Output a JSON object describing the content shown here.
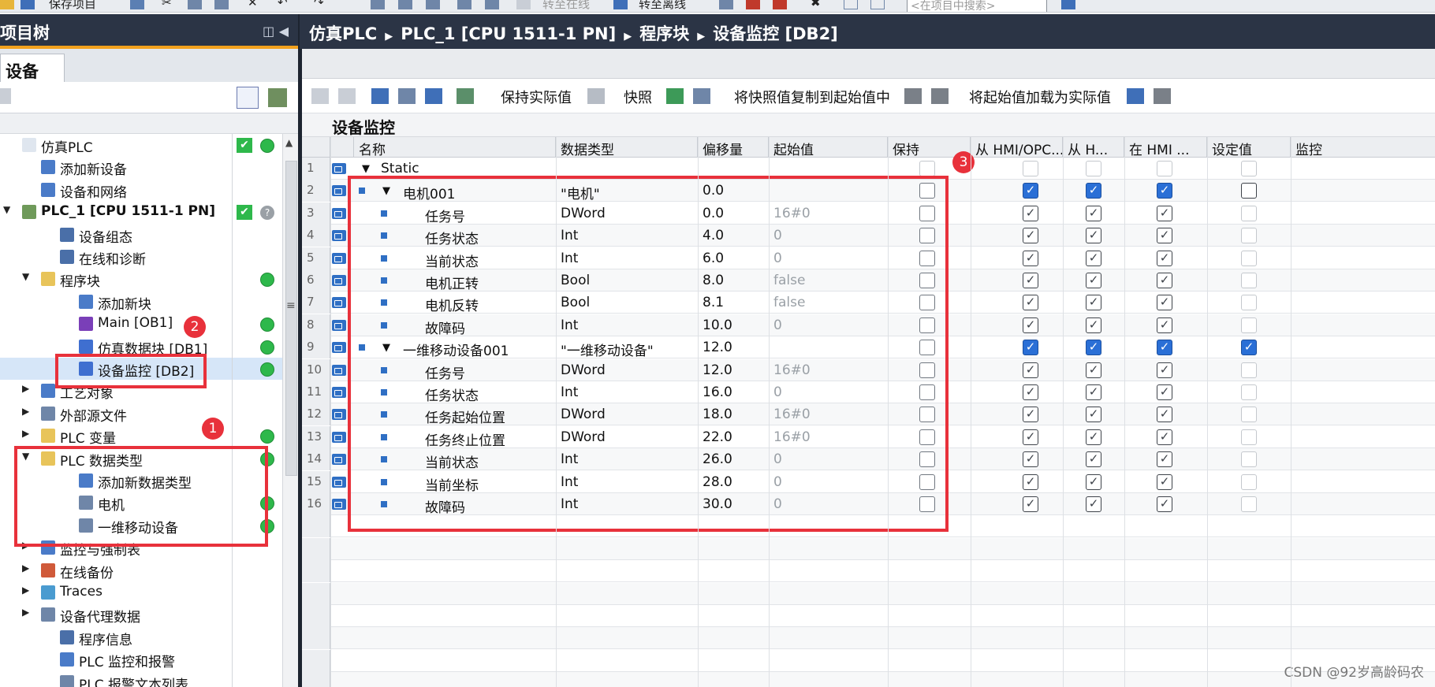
{
  "toolbar": {
    "save_label": "保存项目",
    "go_online": "转至在线",
    "go_offline": "转至离线",
    "search_placeholder": "<在项目中搜索>"
  },
  "left_panel": {
    "title": "项目树",
    "tab": "设备",
    "tree": [
      {
        "label": "仿真PLC",
        "indent": 0,
        "arrow": "",
        "icon": "document-icon",
        "status": "check-dot"
      },
      {
        "label": "添加新设备",
        "indent": 1,
        "arrow": "",
        "icon": "add-device-icon",
        "status": ""
      },
      {
        "label": "设备和网络",
        "indent": 1,
        "arrow": "",
        "icon": "network-icon",
        "status": ""
      },
      {
        "label": "PLC_1 [CPU 1511-1 PN]",
        "indent": 0,
        "arrow": "▼",
        "icon": "plc-icon",
        "status": "check-question",
        "bold": true
      },
      {
        "label": "设备组态",
        "indent": 2,
        "arrow": "",
        "icon": "device-config-icon",
        "status": ""
      },
      {
        "label": "在线和诊断",
        "indent": 2,
        "arrow": "",
        "icon": "diagnostics-icon",
        "status": ""
      },
      {
        "label": "程序块",
        "indent": 1,
        "arrow": "▼",
        "icon": "folder-icon",
        "status": "dot"
      },
      {
        "label": "添加新块",
        "indent": 3,
        "arrow": "",
        "icon": "add-block-icon",
        "status": ""
      },
      {
        "label": "Main [OB1]",
        "indent": 3,
        "arrow": "",
        "icon": "ob-icon",
        "status": "dot"
      },
      {
        "label": "仿真数据块 [DB1]",
        "indent": 3,
        "arrow": "",
        "icon": "db-icon",
        "status": "dot"
      },
      {
        "label": "设备监控 [DB2]",
        "indent": 3,
        "arrow": "",
        "icon": "db-icon",
        "status": "dot",
        "selected": true
      },
      {
        "label": "工艺对象",
        "indent": 1,
        "arrow": "▶",
        "icon": "tech-object-icon",
        "status": ""
      },
      {
        "label": "外部源文件",
        "indent": 1,
        "arrow": "▶",
        "icon": "source-file-icon",
        "status": ""
      },
      {
        "label": "PLC 变量",
        "indent": 1,
        "arrow": "▶",
        "icon": "tag-icon",
        "status": "dot"
      },
      {
        "label": "PLC 数据类型",
        "indent": 1,
        "arrow": "▼",
        "icon": "datatype-folder-icon",
        "status": "dot"
      },
      {
        "label": "添加新数据类型",
        "indent": 3,
        "arrow": "",
        "icon": "add-type-icon",
        "status": ""
      },
      {
        "label": "电机",
        "indent": 3,
        "arrow": "",
        "icon": "udt-icon",
        "status": "dot"
      },
      {
        "label": "一维移动设备",
        "indent": 3,
        "arrow": "",
        "icon": "udt-icon",
        "status": "dot"
      },
      {
        "label": "监控与强制表",
        "indent": 1,
        "arrow": "▶",
        "icon": "watch-table-icon",
        "status": ""
      },
      {
        "label": "在线备份",
        "indent": 1,
        "arrow": "▶",
        "icon": "backup-icon",
        "status": ""
      },
      {
        "label": "Traces",
        "indent": 1,
        "arrow": "▶",
        "icon": "trace-icon",
        "status": ""
      },
      {
        "label": "设备代理数据",
        "indent": 1,
        "arrow": "▶",
        "icon": "proxy-icon",
        "status": ""
      },
      {
        "label": "程序信息",
        "indent": 2,
        "arrow": "",
        "icon": "program-info-icon",
        "status": ""
      },
      {
        "label": "PLC 监控和报警",
        "indent": 2,
        "arrow": "",
        "icon": "alarm-icon",
        "status": ""
      },
      {
        "label": "PLC 报警文本列表",
        "indent": 2,
        "arrow": "",
        "icon": "alarm-text-icon",
        "status": ""
      }
    ]
  },
  "breadcrumb": [
    "仿真PLC",
    "PLC_1 [CPU 1511-1 PN]",
    "程序块",
    "设备监控 [DB2]"
  ],
  "editor_toolbar": {
    "keep_actual": "保持实际值",
    "snapshot": "快照",
    "copy_snapshot": "将快照值复制到起始值中",
    "load_start": "将起始值加载为实际值"
  },
  "block_title": "设备监控",
  "columns": {
    "name": "名称",
    "datatype": "数据类型",
    "offset": "偏移量",
    "start": "起始值",
    "retain": "保持",
    "hmi_opc": "从 HMI/OPC...",
    "from_h": "从 H...",
    "in_hmi": "在 HMI ...",
    "setpoint": "设定值",
    "monitor": "监控"
  },
  "rows": [
    {
      "n": "1",
      "level": 0,
      "arrow": "▼",
      "name": "Static",
      "type": "",
      "offset": "",
      "start": "",
      "retain": false,
      "c1": "dis",
      "c2": "dis",
      "c3": "dis",
      "c4": "dis"
    },
    {
      "n": "2",
      "level": 1,
      "arrow": "▼",
      "name": "电机001",
      "type": "\"电机\"",
      "offset": "0.0",
      "start": "",
      "retain": false,
      "c1": "blue",
      "c2": "blue",
      "c3": "blue",
      "c4": "off"
    },
    {
      "n": "3",
      "level": 2,
      "arrow": "",
      "name": "任务号",
      "type": "DWord",
      "offset": "0.0",
      "start": "16#0",
      "retain": false,
      "c1": "on",
      "c2": "on",
      "c3": "on",
      "c4": "dis"
    },
    {
      "n": "4",
      "level": 2,
      "arrow": "",
      "name": "任务状态",
      "type": "Int",
      "offset": "4.0",
      "start": "0",
      "retain": false,
      "c1": "on",
      "c2": "on",
      "c3": "on",
      "c4": "dis"
    },
    {
      "n": "5",
      "level": 2,
      "arrow": "",
      "name": "当前状态",
      "type": "Int",
      "offset": "6.0",
      "start": "0",
      "retain": false,
      "c1": "on",
      "c2": "on",
      "c3": "on",
      "c4": "dis"
    },
    {
      "n": "6",
      "level": 2,
      "arrow": "",
      "name": "电机正转",
      "type": "Bool",
      "offset": "8.0",
      "start": "false",
      "retain": false,
      "c1": "on",
      "c2": "on",
      "c3": "on",
      "c4": "dis"
    },
    {
      "n": "7",
      "level": 2,
      "arrow": "",
      "name": "电机反转",
      "type": "Bool",
      "offset": "8.1",
      "start": "false",
      "retain": false,
      "c1": "on",
      "c2": "on",
      "c3": "on",
      "c4": "dis"
    },
    {
      "n": "8",
      "level": 2,
      "arrow": "",
      "name": "故障码",
      "type": "Int",
      "offset": "10.0",
      "start": "0",
      "retain": false,
      "c1": "on",
      "c2": "on",
      "c3": "on",
      "c4": "dis"
    },
    {
      "n": "9",
      "level": 1,
      "arrow": "▼",
      "name": "一维移动设备001",
      "type": "\"一维移动设备\"",
      "offset": "12.0",
      "start": "",
      "retain": false,
      "c1": "blue",
      "c2": "blue",
      "c3": "blue",
      "c4": "blue"
    },
    {
      "n": "10",
      "level": 2,
      "arrow": "",
      "name": "任务号",
      "type": "DWord",
      "offset": "12.0",
      "start": "16#0",
      "retain": false,
      "c1": "on",
      "c2": "on",
      "c3": "on",
      "c4": "dis"
    },
    {
      "n": "11",
      "level": 2,
      "arrow": "",
      "name": "任务状态",
      "type": "Int",
      "offset": "16.0",
      "start": "0",
      "retain": false,
      "c1": "on",
      "c2": "on",
      "c3": "on",
      "c4": "dis"
    },
    {
      "n": "12",
      "level": 2,
      "arrow": "",
      "name": "任务起始位置",
      "type": "DWord",
      "offset": "18.0",
      "start": "16#0",
      "retain": false,
      "c1": "on",
      "c2": "on",
      "c3": "on",
      "c4": "dis"
    },
    {
      "n": "13",
      "level": 2,
      "arrow": "",
      "name": "任务终止位置",
      "type": "DWord",
      "offset": "22.0",
      "start": "16#0",
      "retain": false,
      "c1": "on",
      "c2": "on",
      "c3": "on",
      "c4": "dis"
    },
    {
      "n": "14",
      "level": 2,
      "arrow": "",
      "name": "当前状态",
      "type": "Int",
      "offset": "26.0",
      "start": "0",
      "retain": false,
      "c1": "on",
      "c2": "on",
      "c3": "on",
      "c4": "dis"
    },
    {
      "n": "15",
      "level": 2,
      "arrow": "",
      "name": "当前坐标",
      "type": "Int",
      "offset": "28.0",
      "start": "0",
      "retain": false,
      "c1": "on",
      "c2": "on",
      "c3": "on",
      "c4": "dis"
    },
    {
      "n": "16",
      "level": 2,
      "arrow": "",
      "name": "故障码",
      "type": "Int",
      "offset": "30.0",
      "start": "0",
      "retain": false,
      "c1": "on",
      "c2": "on",
      "c3": "on",
      "c4": "dis"
    }
  ],
  "annotations": {
    "b1": "1",
    "b2": "2",
    "b3": "3"
  },
  "watermark": "CSDN @92岁高龄码农",
  "colors": {
    "accent": "#f2a11d",
    "header": "#2b3445",
    "highlight": "#e8313b",
    "ok": "#2eb84b",
    "checked": "#2a6fd6"
  }
}
